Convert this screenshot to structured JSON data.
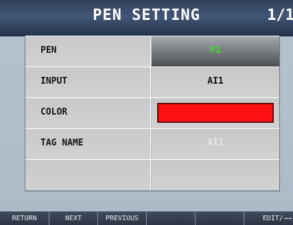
{
  "header": {
    "title": "PEN SETTING",
    "page": "1/1"
  },
  "rows": [
    {
      "label": "PEN",
      "value": "P1",
      "value_color": "#3bdc2c"
    },
    {
      "label": "INPUT",
      "value": "AI1"
    },
    {
      "label": "COLOR",
      "color": "#ff1010"
    },
    {
      "label": "TAG NAME",
      "value": "AI1"
    },
    {
      "label": "",
      "value": ""
    }
  ],
  "footer": {
    "buttons": [
      "RETURN",
      "NEXT",
      "PREVIOUS",
      "",
      "",
      "EDIT/→→"
    ]
  }
}
